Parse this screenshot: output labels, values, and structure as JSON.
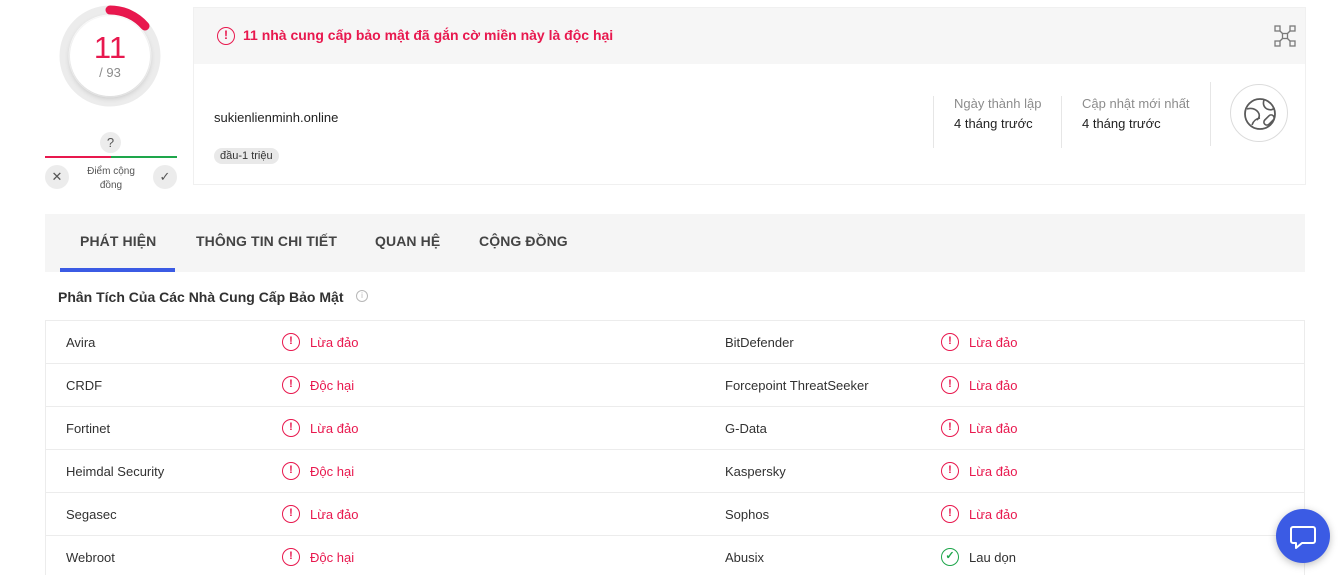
{
  "score": {
    "detections": "11",
    "total": "/ 93"
  },
  "community": {
    "badge": "?",
    "label": "Điểm cộng đồng",
    "reject_icon": "close-icon",
    "accept_icon": "check-icon"
  },
  "alert": {
    "icon": "exclamation-circle-icon",
    "text": "11 nhà cung cấp bảo mật đã gắn cờ miền này là độc hại"
  },
  "domain": {
    "name": "sukienlienminh.online",
    "tag": "đầu-1 triệu"
  },
  "meta": [
    {
      "label": "Ngày thành lập",
      "value": "4 tháng trước"
    },
    {
      "label": "Cập nhật mới nhất",
      "value": "4 tháng trước"
    }
  ],
  "tabs": [
    "PHÁT HIỆN",
    "THÔNG TIN CHI TIẾT",
    "QUAN HỆ",
    "CỘNG ĐỒNG"
  ],
  "section": {
    "title": "Phân Tích Của Các Nhà Cung Cấp Bảo Mật",
    "info_icon": "i"
  },
  "vendors": [
    {
      "left": {
        "name": "Avira",
        "result": "Lừa đảo",
        "status": "malicious"
      },
      "right": {
        "name": "BitDefender",
        "result": "Lừa đảo",
        "status": "malicious"
      }
    },
    {
      "left": {
        "name": "CRDF",
        "result": "Độc hại",
        "status": "malicious"
      },
      "right": {
        "name": "Forcepoint ThreatSeeker",
        "result": "Lừa đảo",
        "status": "malicious"
      }
    },
    {
      "left": {
        "name": "Fortinet",
        "result": "Lừa đảo",
        "status": "malicious"
      },
      "right": {
        "name": "G-Data",
        "result": "Lừa đảo",
        "status": "malicious"
      }
    },
    {
      "left": {
        "name": "Heimdal Security",
        "result": "Độc hại",
        "status": "malicious"
      },
      "right": {
        "name": "Kaspersky",
        "result": "Lừa đảo",
        "status": "malicious"
      }
    },
    {
      "left": {
        "name": "Segasec",
        "result": "Lừa đảo",
        "status": "malicious"
      },
      "right": {
        "name": "Sophos",
        "result": "Lừa đảo",
        "status": "malicious"
      }
    },
    {
      "left": {
        "name": "Webroot",
        "result": "Độc hại",
        "status": "malicious"
      },
      "right": {
        "name": "Abusix",
        "result": "Lau dọn",
        "status": "clean"
      }
    }
  ],
  "colors": {
    "malicious": "#e8184e",
    "clean": "#1ea64b",
    "accent": "#3b5be4"
  }
}
